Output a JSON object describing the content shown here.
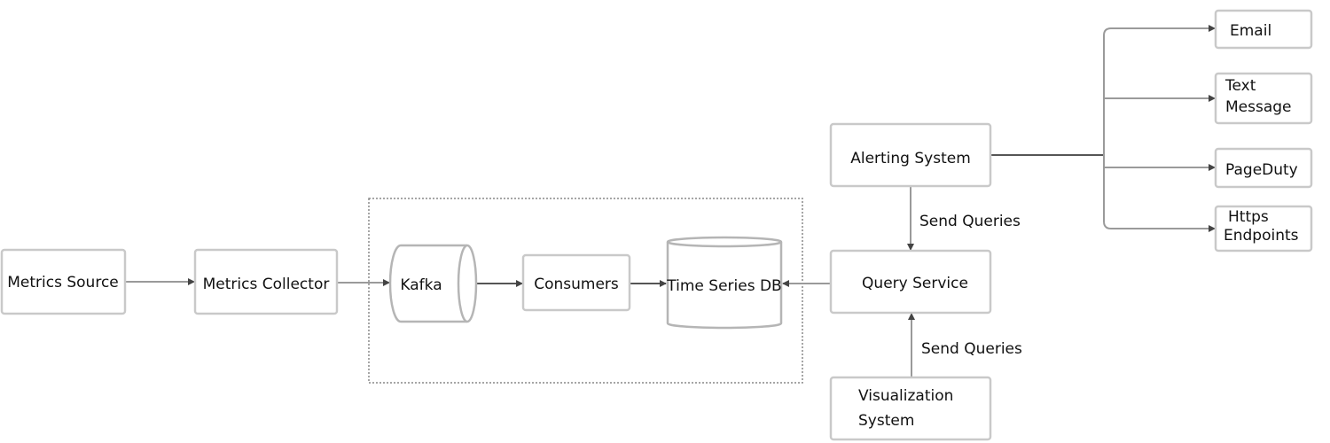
{
  "nodes": {
    "metrics_source": "Metrics Source",
    "metrics_collector": "Metrics Collector",
    "kafka": "Kafka",
    "consumers": "Consumers",
    "time_series_db": "Time Series DB",
    "query_service": "Query Service",
    "alerting_system": "Alerting System",
    "visualization_system": [
      "Visualization",
      "System"
    ],
    "email": "Email",
    "text_message": [
      "Text",
      "Message"
    ],
    "pageduty": "PageDuty",
    "https_endpoints": [
      "Https",
      "Endpoints"
    ]
  },
  "edges": {
    "alerting_to_query_label": "Send Queries",
    "visualization_to_query_label": "Send Queries"
  },
  "colors": {
    "box_border": "#c9c9c9",
    "arrow": "#9a9a9a"
  }
}
